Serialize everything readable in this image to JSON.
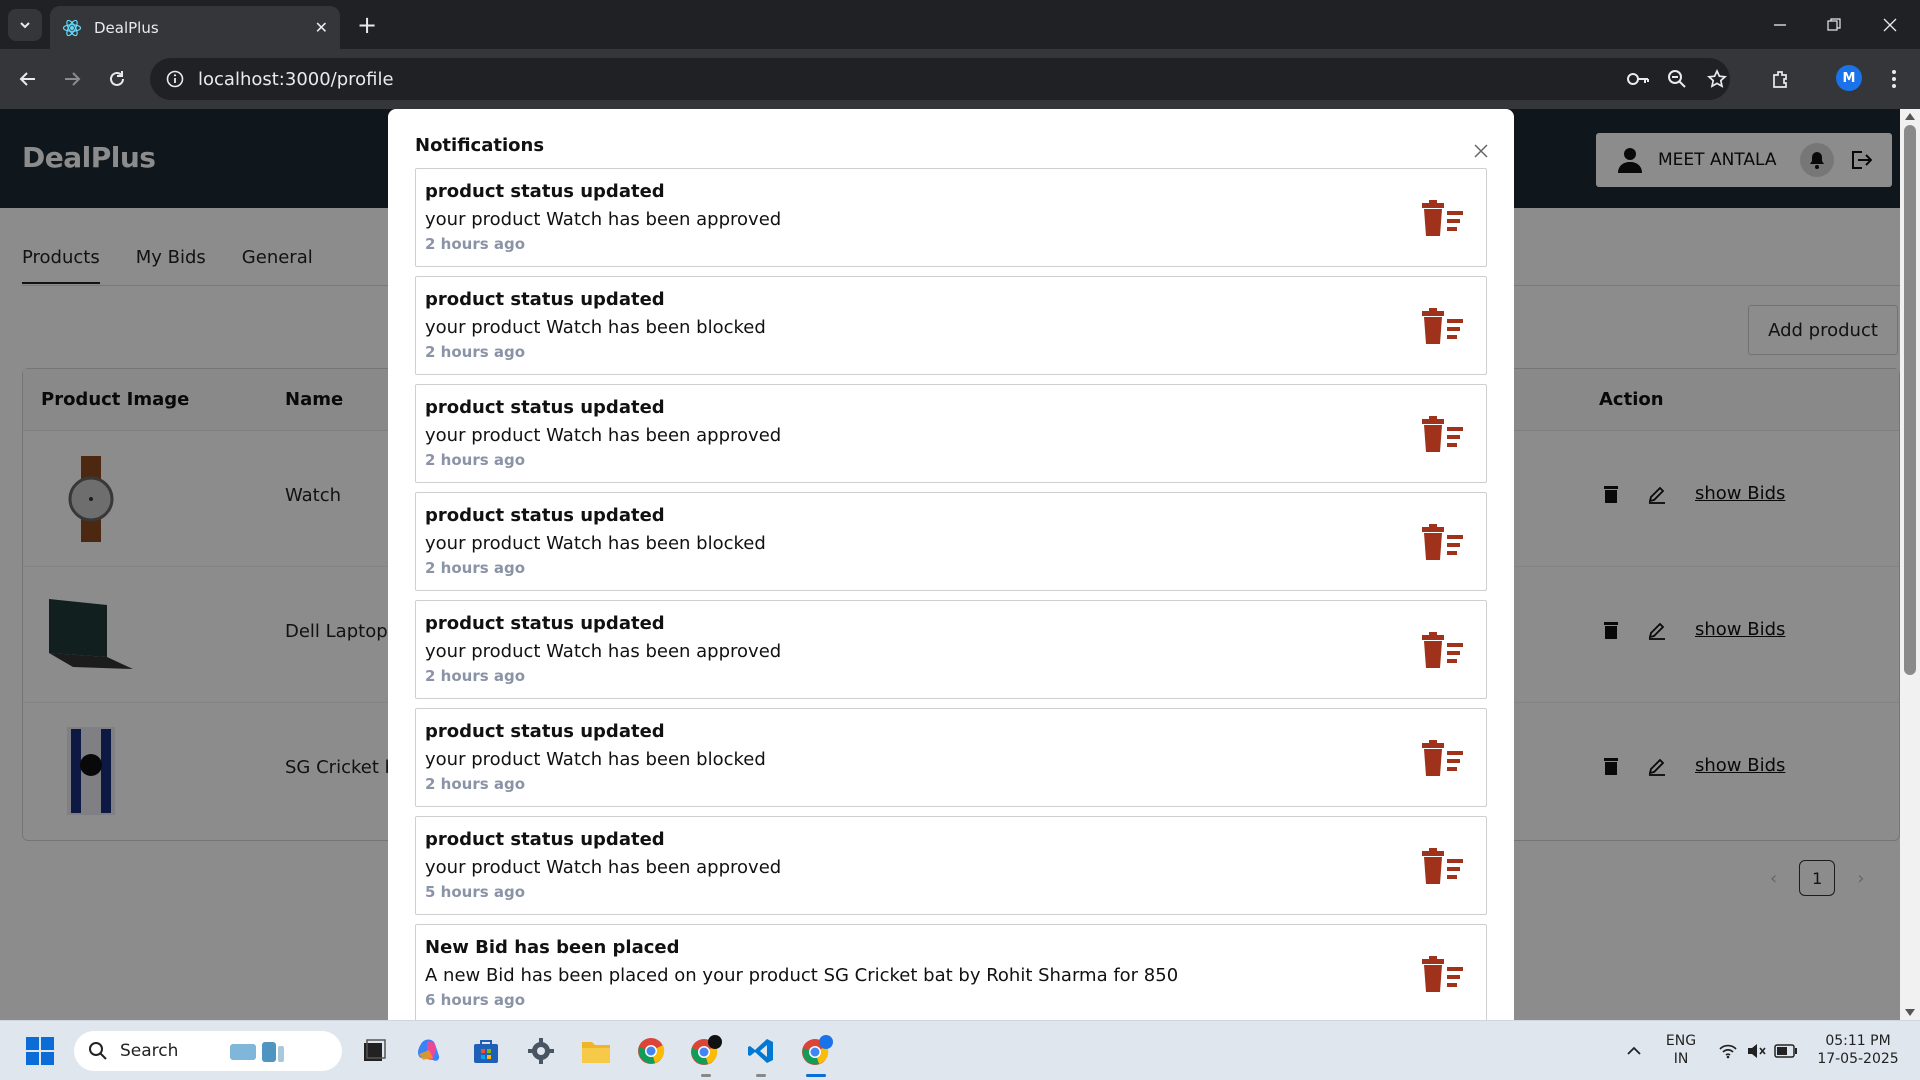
{
  "browser": {
    "tab_title": "DealPlus",
    "url": "localhost:3000/profile",
    "profile_initial": "M"
  },
  "app": {
    "brand": "DealPlus",
    "user_name": "MEET ANTALA",
    "tabs": [
      "Products",
      "My Bids",
      "General"
    ],
    "add_product_label": "Add product",
    "table_headers": {
      "image": "Product Image",
      "name": "Name",
      "action": "Action"
    },
    "products": [
      {
        "name": "Watch",
        "show_bids": "show Bids"
      },
      {
        "name": "Dell Laptop",
        "show_bids": "show Bids"
      },
      {
        "name": "SG Cricket b",
        "show_bids": "show Bids"
      }
    ],
    "page_number": "1"
  },
  "modal": {
    "title": "Notifications",
    "notifications": [
      {
        "title": "product status updated",
        "message": "your product Watch has been approved",
        "time": "2 hours ago"
      },
      {
        "title": "product status updated",
        "message": "your product Watch has been blocked",
        "time": "2 hours ago"
      },
      {
        "title": "product status updated",
        "message": "your product Watch has been approved",
        "time": "2 hours ago"
      },
      {
        "title": "product status updated",
        "message": "your product Watch has been blocked",
        "time": "2 hours ago"
      },
      {
        "title": "product status updated",
        "message": "your product Watch has been approved",
        "time": "2 hours ago"
      },
      {
        "title": "product status updated",
        "message": "your product Watch has been blocked",
        "time": "2 hours ago"
      },
      {
        "title": "product status updated",
        "message": "your product Watch has been approved",
        "time": "5 hours ago"
      },
      {
        "title": "New Bid has been placed",
        "message": "A new Bid has been placed on your product SG Cricket bat by Rohit Sharma for 850",
        "time": "6 hours ago"
      }
    ]
  },
  "taskbar": {
    "search_placeholder": "Search",
    "lang_line1": "ENG",
    "lang_line2": "IN",
    "time": "05:11 PM",
    "date": "17-05-2025"
  },
  "colors": {
    "header_bg": "#1c2b35",
    "delete_icon": "#a0321c",
    "time_text": "#8a94a6"
  }
}
